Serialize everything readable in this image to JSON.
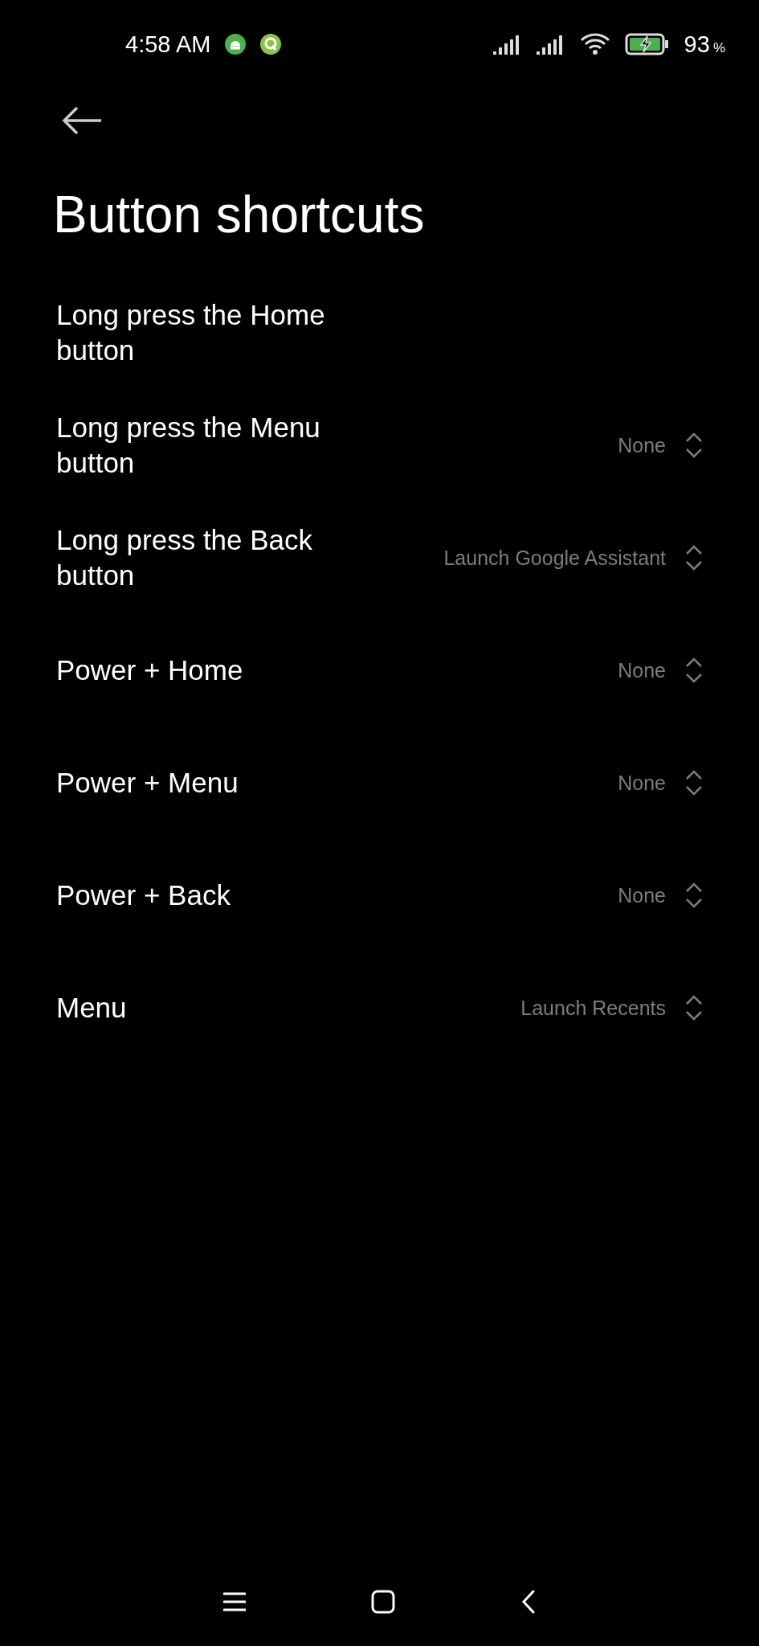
{
  "status_bar": {
    "time": "4:58 AM",
    "battery": "93",
    "battery_unit": "%"
  },
  "title": "Button shortcuts",
  "items": [
    {
      "label": "Long press the Home button"
    },
    {
      "label": "Long press the Menu button",
      "value": "None"
    },
    {
      "label": "Long press the Back button",
      "value": "Launch Google Assistant"
    },
    {
      "label": "Power + Home",
      "value": "None"
    },
    {
      "label": "Power + Menu",
      "value": "None"
    },
    {
      "label": "Power + Back",
      "value": "None"
    },
    {
      "label": "Menu",
      "value": "Launch Recents"
    }
  ]
}
